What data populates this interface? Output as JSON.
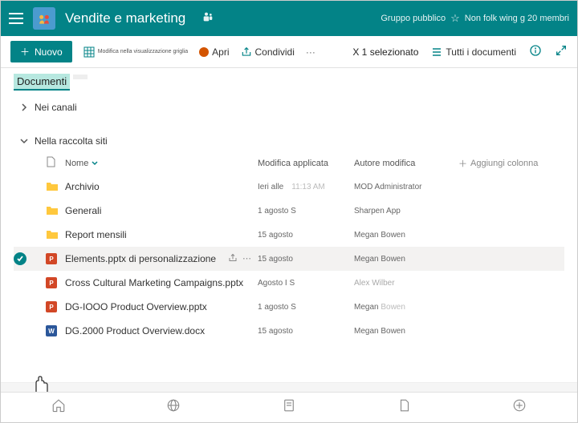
{
  "header": {
    "title": "Vendite e marketing",
    "group_type": "Gruppo pubblico",
    "members": "Non folk wing g 20 membri"
  },
  "toolbar": {
    "new_label": "Nuovo",
    "edit_view": "Modifica nella visualizzazione griglia",
    "open": "Apri",
    "share": "Condividi",
    "more": "···",
    "selected": "X 1 selezionato",
    "all_docs": "Tutti i documenti"
  },
  "tabs": {
    "documents": "Documenti"
  },
  "sections": {
    "channels": "Nei canali",
    "site_collection": "Nella raccolta siti"
  },
  "columns": {
    "name": "Nome",
    "modified": "Modifica applicata",
    "modified_by": "Autore modifica",
    "add": "Aggiungi colonna"
  },
  "rows": [
    {
      "type": "folder",
      "name": "Archivio",
      "modified": "Ieri alle",
      "time": "11:13 AM",
      "author": "MOD Administrator"
    },
    {
      "type": "folder",
      "name": "Generali",
      "modified": "1 agosto S",
      "author": "Sharpen App"
    },
    {
      "type": "folder",
      "name": "Report mensili",
      "modified": "15 agosto",
      "author": "Megan Bowen"
    },
    {
      "type": "pptx",
      "name": "Elements.pptx di personalizzazione",
      "modified": "15 agosto",
      "author": "Megan Bowen",
      "selected": true
    },
    {
      "type": "pptx",
      "name": "Cross Cultural Marketing Campaigns.pptx",
      "modified": "Agosto I S",
      "author": "Alex Wilber",
      "light": true
    },
    {
      "type": "pptx",
      "name": "DG-IOOO Product Overview.pptx",
      "modified": "1 agosto S",
      "author": "Megan",
      "author2": "Bowen"
    },
    {
      "type": "docx",
      "name": "DG.2000 Product Overview.docx",
      "modified": "15 agosto",
      "author": "Megan Bowen"
    }
  ]
}
